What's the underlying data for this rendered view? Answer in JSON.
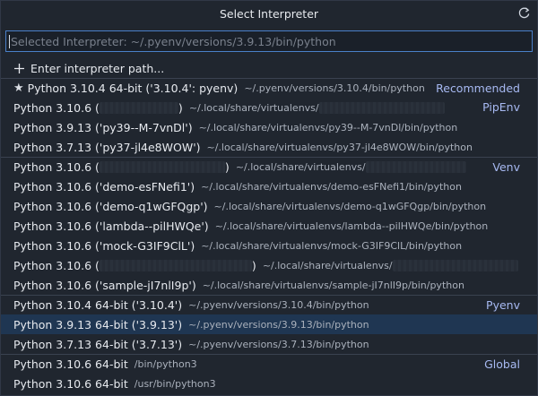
{
  "title": "Select Interpreter",
  "input": {
    "placeholder": "Selected Interpreter: ~/.pyenv/versions/3.9.13/bin/python",
    "value": ""
  },
  "colors": {
    "accent": "#4a80c9",
    "group_label": "#a7b9f2",
    "selected_row": "#1f3652"
  },
  "icons": {
    "refresh": "refresh-icon",
    "add": "plus-icon",
    "recommended": "star-icon"
  },
  "items": [
    {
      "label": "Enter interpreter path...",
      "desc": "",
      "group": "",
      "icon": "plus"
    },
    {
      "label": "Python 3.10.4 64-bit ('3.10.4': pyenv)",
      "desc": "~/.pyenv/versions/3.10.4/bin/python",
      "group": "Recommended",
      "icon": "star"
    },
    {
      "label": "Python 3.10.6 (",
      "label_tail": ")",
      "desc": "~/.local/share/virtualenvs/",
      "group": "PipEnv",
      "redact_label": 88,
      "redact_desc": 140
    },
    {
      "label": "Python 3.9.13 ('py39--M-7vnDl')",
      "desc": "~/.local/share/virtualenvs/py39--M-7vnDl/bin/python",
      "group": ""
    },
    {
      "label": "Python 3.7.13 ('py37-jl4e8WOW')",
      "desc": "~/.local/share/virtualenvs/py37-jl4e8WOW/bin/python",
      "group": ""
    },
    {
      "label": "Python 3.10.6 (",
      "label_tail": ")",
      "desc": "~/.local/share/virtualenvs/",
      "group": "Venv",
      "redact_label": 140,
      "redact_desc": 112
    },
    {
      "label": "Python 3.10.6 ('demo-esFNefi1')",
      "desc": "~/.local/share/virtualenvs/demo-esFNefi1/bin/python",
      "group": ""
    },
    {
      "label": "Python 3.10.6 ('demo-q1wGFQgp')",
      "desc": "~/.local/share/virtualenvs/demo-q1wGFQgp/bin/python",
      "group": ""
    },
    {
      "label": "Python 3.10.6 ('lambda--pilHWQe')",
      "desc": "~/.local/share/virtualenvs/lambda--pilHWQe/bin/python",
      "group": ""
    },
    {
      "label": "Python 3.10.6 ('mock-G3IF9ClL')",
      "desc": "~/.local/share/virtualenvs/mock-G3IF9ClL/bin/python",
      "group": ""
    },
    {
      "label": "Python 3.10.6 (",
      "label_tail": ")",
      "desc": "~/.local/share/virtualenvs/",
      "group": "",
      "redact_label": 170,
      "redact_desc": 140
    },
    {
      "label": "Python 3.10.6 ('sample-jI7nlI9p')",
      "desc": "~/.local/share/virtualenvs/sample-jI7nlI9p/bin/python",
      "group": ""
    },
    {
      "label": "Python 3.10.4 64-bit ('3.10.4')",
      "desc": "~/.pyenv/versions/3.10.4/bin/python",
      "group": "Pyenv"
    },
    {
      "label": "Python 3.9.13 64-bit ('3.9.13')",
      "desc": "~/.pyenv/versions/3.9.13/bin/python",
      "group": "",
      "selected": true
    },
    {
      "label": "Python 3.7.13 64-bit ('3.7.13')",
      "desc": "~/.pyenv/versions/3.7.13/bin/python",
      "group": ""
    },
    {
      "label": "Python 3.10.6 64-bit",
      "desc": "/bin/python3",
      "group": "Global"
    },
    {
      "label": "Python 3.10.6 64-bit",
      "desc": "/usr/bin/python3",
      "group": ""
    }
  ]
}
